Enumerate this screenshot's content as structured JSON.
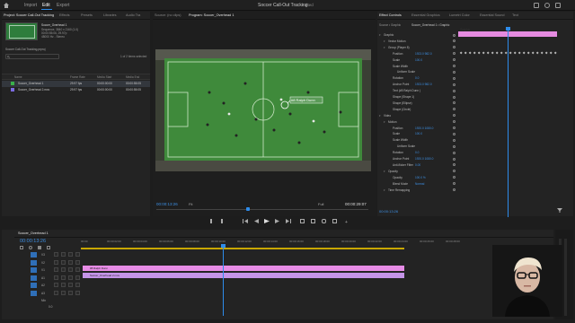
{
  "menu": {
    "import": "Import",
    "edit": "Edit",
    "export": "Export",
    "title": "Soccer Call-Out Tracking",
    "edited": "Edited"
  },
  "project": {
    "tabs": [
      "Project: Soccer Call-Out Tracking",
      "Effects",
      "Presets",
      "Libraries",
      "Audio Tra"
    ],
    "sequence_name": "Soccer_Overhead 1",
    "info": [
      "Sequence, 3840 x 2160 (1.0)",
      "00:00:55:06, 29.97p",
      "48000 Hz - Stereo"
    ],
    "file_name": "Soccer Call-Out Tracking.prproj",
    "selected_count": "1 of 2 items selected",
    "columns": [
      "Name",
      "Frame Rate",
      "Media Start",
      "Media End"
    ],
    "rows": [
      {
        "name": "Soccer_Overhead 1",
        "rate": "29.97 fps",
        "start": "00:00:00:00",
        "end": "00:00:55:05",
        "color": "#3ab04a"
      },
      {
        "name": "Soccer_Overhead 2.mov",
        "rate": "29.97 fps",
        "start": "00:00:00:00",
        "end": "00:00:55:05",
        "color": "#7c6be0"
      }
    ]
  },
  "monitor": {
    "tabs": [
      "Source: (no clips)",
      "Program: Soccer_Overhead 1"
    ],
    "callout": "#8 Ralph Dunn",
    "timecode": "00:00:13:26",
    "fit": "Fit",
    "quality": "Full",
    "duration": "00:00:29:07"
  },
  "effects": {
    "tabs": [
      "Effect Controls",
      "Essential Graphics",
      "Lumetri Color",
      "Essential Sound",
      "Text"
    ],
    "source": "Source • Graphic",
    "clip": "Soccer_Overhead 1 • Graphic",
    "clip_label": "Graphic",
    "rows": [
      {
        "label": "Graphic",
        "value": "",
        "indent": 0
      },
      {
        "label": "Vector Motion",
        "value": "",
        "indent": 1
      },
      {
        "label": "Group (Player 8)",
        "value": "",
        "indent": 1
      },
      {
        "label": "Position",
        "value": "1923.0   982.0",
        "indent": 2
      },
      {
        "label": "Scale",
        "value": "100.0",
        "indent": 2
      },
      {
        "label": "Scale Width",
        "value": "",
        "indent": 2
      },
      {
        "label": "Uniform Scale",
        "value": "",
        "indent": 3
      },
      {
        "label": "Rotation",
        "value": "0.0",
        "indent": 2
      },
      {
        "label": "Anchor Point",
        "value": "1923.0   982.0",
        "indent": 2
      },
      {
        "label": "Text (#8 Ralph Dunn )",
        "value": "",
        "indent": 2
      },
      {
        "label": "Shape (Shape 1)",
        "value": "",
        "indent": 2
      },
      {
        "label": "Shape (Ellipse)",
        "value": "",
        "indent": 2
      },
      {
        "label": "Shape (Circle)",
        "value": "",
        "indent": 2
      },
      {
        "label": "Video",
        "value": "",
        "indent": 0
      },
      {
        "label": "Motion",
        "value": "",
        "indent": 1
      },
      {
        "label": "Position",
        "value": "1920.0   1080.0",
        "indent": 2
      },
      {
        "label": "Scale",
        "value": "100.0",
        "indent": 2
      },
      {
        "label": "Scale Width",
        "value": "",
        "indent": 2
      },
      {
        "label": "Uniform Scale",
        "value": "",
        "indent": 3
      },
      {
        "label": "Rotation",
        "value": "0.0",
        "indent": 2
      },
      {
        "label": "Anchor Point",
        "value": "1920.0   1080.0",
        "indent": 2
      },
      {
        "label": "Anti-flicker Filter",
        "value": "0.00",
        "indent": 2
      },
      {
        "label": "Opacity",
        "value": "",
        "indent": 1
      },
      {
        "label": "Opacity",
        "value": "100.0 %",
        "indent": 2
      },
      {
        "label": "Blend Mode",
        "value": "Normal",
        "indent": 2
      },
      {
        "label": "Time Remapping",
        "value": "",
        "indent": 1
      }
    ],
    "current_time": "00:00:13:26"
  },
  "timeline": {
    "tab": "Soccer_Overhead 1",
    "timecode": "00:00:13:26",
    "ruler": [
      "00:00",
      "00:00:02:00",
      "00:00:04:00",
      "00:00:06:00",
      "00:00:08:00",
      "00:00:10:00",
      "00:00:12:00",
      "00:00:14:00",
      "00:00:16:00",
      "00:00:18:00",
      "00:00:20:00",
      "00:00:22:00",
      "00:00:24:00",
      "00:00:26:00",
      "00:00:28:00"
    ],
    "tracks": [
      {
        "name": "V3",
        "type": "video"
      },
      {
        "name": "V2",
        "type": "video"
      },
      {
        "name": "V1",
        "type": "video"
      },
      {
        "name": "A1",
        "type": "audio"
      },
      {
        "name": "A2",
        "type": "audio"
      },
      {
        "name": "A3",
        "type": "audio"
      },
      {
        "name": "Mix",
        "type": "mix"
      }
    ],
    "mix_value": "0.0",
    "clips": [
      {
        "label": "#8 Ralph Dunn",
        "color": "#e78ce6"
      },
      {
        "label": "Soccer_Overhead 2.mov",
        "color": "#c594e8"
      }
    ]
  },
  "colors": {
    "accent": "#2d8ceb",
    "pink": "#e78ce6",
    "field": "#3c8a3a"
  }
}
